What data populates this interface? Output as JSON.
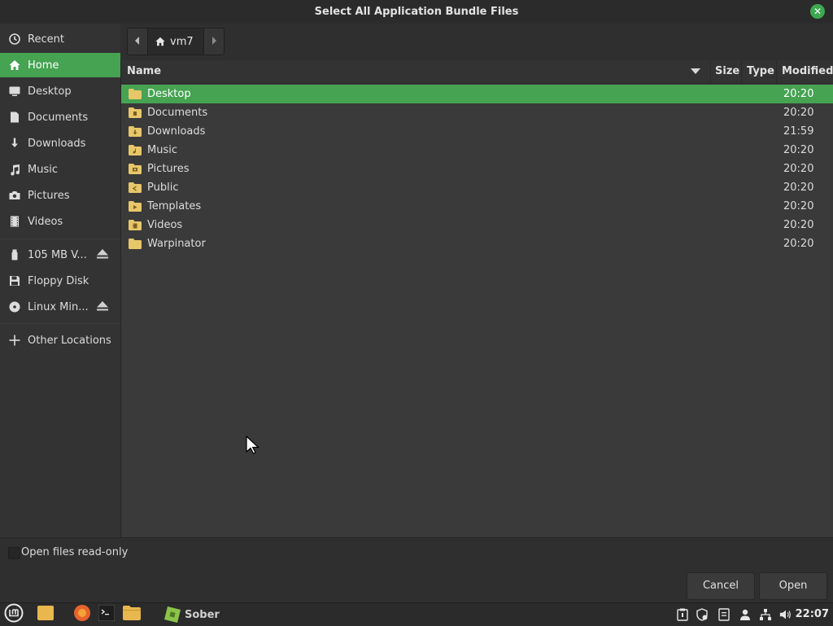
{
  "window": {
    "title": "Select All Application Bundle Files"
  },
  "sidebar": {
    "items": [
      {
        "label": "Recent",
        "icon": "clock-icon"
      },
      {
        "label": "Home",
        "icon": "home-icon"
      },
      {
        "label": "Desktop",
        "icon": "desktop-icon"
      },
      {
        "label": "Documents",
        "icon": "document-icon"
      },
      {
        "label": "Downloads",
        "icon": "download-icon"
      },
      {
        "label": "Music",
        "icon": "music-icon"
      },
      {
        "label": "Pictures",
        "icon": "camera-icon"
      },
      {
        "label": "Videos",
        "icon": "film-icon"
      }
    ],
    "devices": [
      {
        "label": "105 MB V...",
        "icon": "usb-drive-icon"
      },
      {
        "label": "Floppy Disk",
        "icon": "floppy-icon"
      },
      {
        "label": "Linux Min...",
        "icon": "disc-icon"
      }
    ],
    "other": {
      "label": "Other Locations",
      "icon": "plus-icon"
    }
  },
  "pathbar": {
    "current": "vm7"
  },
  "columns": {
    "name": "Name",
    "size": "Size",
    "type": "Type",
    "modified": "Modified"
  },
  "files": [
    {
      "name": "Desktop",
      "modified": "20:20",
      "icon": "folder-desktop-icon"
    },
    {
      "name": "Documents",
      "modified": "20:20",
      "icon": "folder-documents-icon"
    },
    {
      "name": "Downloads",
      "modified": "21:59",
      "icon": "folder-downloads-icon"
    },
    {
      "name": "Music",
      "modified": "20:20",
      "icon": "folder-music-icon"
    },
    {
      "name": "Pictures",
      "modified": "20:20",
      "icon": "folder-pictures-icon"
    },
    {
      "name": "Public",
      "modified": "20:20",
      "icon": "folder-public-icon"
    },
    {
      "name": "Templates",
      "modified": "20:20",
      "icon": "folder-templates-icon"
    },
    {
      "name": "Videos",
      "modified": "20:20",
      "icon": "folder-videos-icon"
    },
    {
      "name": "Warpinator",
      "modified": "20:20",
      "icon": "folder-icon"
    }
  ],
  "options": {
    "read_only_label": "Open files read-only"
  },
  "buttons": {
    "cancel": "Cancel",
    "open": "Open"
  },
  "taskbar": {
    "sober_label": "Sober",
    "clock": "22:07"
  },
  "colors": {
    "accent": "#45a352",
    "folder": "#e8c76a"
  }
}
